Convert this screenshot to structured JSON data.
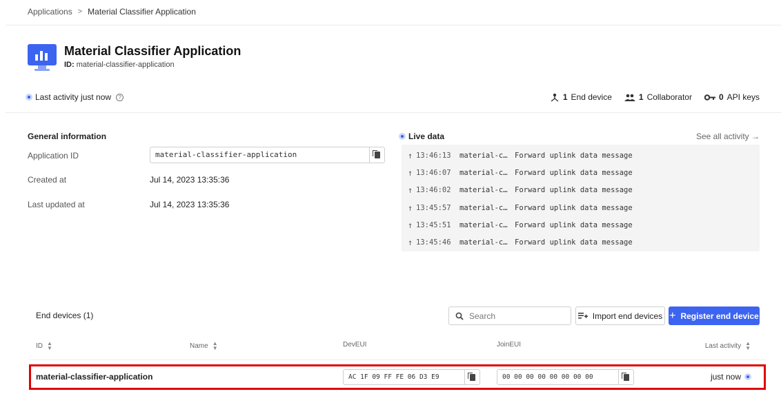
{
  "breadcrumb": {
    "root": "Applications",
    "separator": ">",
    "current": "Material Classifier Application"
  },
  "header": {
    "title": "Material Classifier Application",
    "id_label": "ID:",
    "id_value": "material-classifier-application"
  },
  "activity": {
    "text": "Last activity just now"
  },
  "stats": {
    "end_devices_count": "1",
    "end_devices_label": "End device",
    "collaborators_count": "1",
    "collaborators_label": "Collaborator",
    "api_keys_count": "0",
    "api_keys_label": "API keys"
  },
  "general": {
    "title": "General information",
    "application_id_label": "Application ID",
    "application_id_value": "material-classifier-application",
    "created_label": "Created at",
    "created_value": "Jul 14, 2023 13:35:36",
    "updated_label": "Last updated at",
    "updated_value": "Jul 14, 2023 13:35:36"
  },
  "live": {
    "title": "Live data",
    "see_all": "See all activity →",
    "rows": [
      {
        "time": "13:46:13",
        "device": "material-c…",
        "message": "Forward uplink data message"
      },
      {
        "time": "13:46:07",
        "device": "material-c…",
        "message": "Forward uplink data message"
      },
      {
        "time": "13:46:02",
        "device": "material-c…",
        "message": "Forward uplink data message"
      },
      {
        "time": "13:45:57",
        "device": "material-c…",
        "message": "Forward uplink data message"
      },
      {
        "time": "13:45:51",
        "device": "material-c…",
        "message": "Forward uplink data message"
      },
      {
        "time": "13:45:46",
        "device": "material-c…",
        "message": "Forward uplink data message"
      }
    ]
  },
  "end_devices": {
    "title": "End devices (1)",
    "search_placeholder": "Search",
    "import_label": "Import end devices",
    "register_label": "Register end device",
    "columns": {
      "id": "ID",
      "name": "Name",
      "dev_eui": "DevEUI",
      "join_eui": "JoinEUI",
      "last_activity": "Last activity"
    },
    "rows": [
      {
        "id": "material-classifier-application",
        "name": "",
        "dev_eui": "AC 1F 09 FF FE 06 D3 E9",
        "join_eui": "00 00 00 00 00 00 00 00",
        "last_activity": "just now"
      }
    ]
  },
  "colors": {
    "accent": "#3c64f0",
    "highlight_outline": "#e00000",
    "status_dot": "#3760e0"
  },
  "icons": {
    "app": "app-chart-icon",
    "help": "help-icon",
    "device": "device-icon",
    "collaborator": "people-icon",
    "key": "key-icon",
    "copy": "copy-icon",
    "uplink": "arrow-up-icon",
    "search": "search-icon",
    "import": "import-icon",
    "add": "plus-icon",
    "sort": "sort-icon"
  }
}
